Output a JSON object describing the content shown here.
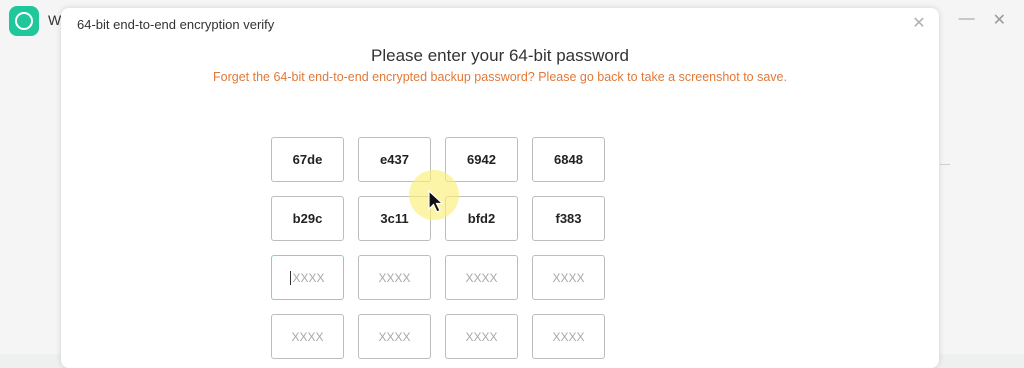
{
  "background_app": {
    "title": "W",
    "app_icon": "whatsapp-transfer-icon",
    "minimize_glyph": "—",
    "close_glyph": "✕"
  },
  "dialog": {
    "title": "64-bit end-to-end encryption verify",
    "close_glyph": "✕",
    "heading": "Please enter your 64-bit password",
    "subheading": "Forget the 64-bit end-to-end encrypted backup password? Please go back to take a screenshot to save."
  },
  "password_fields": [
    {
      "value": "67de",
      "placeholder": "XXXX"
    },
    {
      "value": "e437",
      "placeholder": "XXXX"
    },
    {
      "value": "6942",
      "placeholder": "XXXX"
    },
    {
      "value": "6848",
      "placeholder": "XXXX"
    },
    {
      "value": "b29c",
      "placeholder": "XXXX"
    },
    {
      "value": "3c11",
      "placeholder": "XXXX"
    },
    {
      "value": "bfd2",
      "placeholder": "XXXX"
    },
    {
      "value": "f383",
      "placeholder": "XXXX"
    },
    {
      "value": "",
      "placeholder": "XXXX"
    },
    {
      "value": "",
      "placeholder": "XXXX"
    },
    {
      "value": "",
      "placeholder": "XXXX"
    },
    {
      "value": "",
      "placeholder": "XXXX"
    },
    {
      "value": "",
      "placeholder": "XXXX"
    },
    {
      "value": "",
      "placeholder": "XXXX"
    },
    {
      "value": "",
      "placeholder": "XXXX"
    },
    {
      "value": "",
      "placeholder": "XXXX"
    }
  ],
  "colors": {
    "accent_orange": "#e07a3a",
    "active_border": "#7fd6bd",
    "app_green": "#1fc79a"
  }
}
